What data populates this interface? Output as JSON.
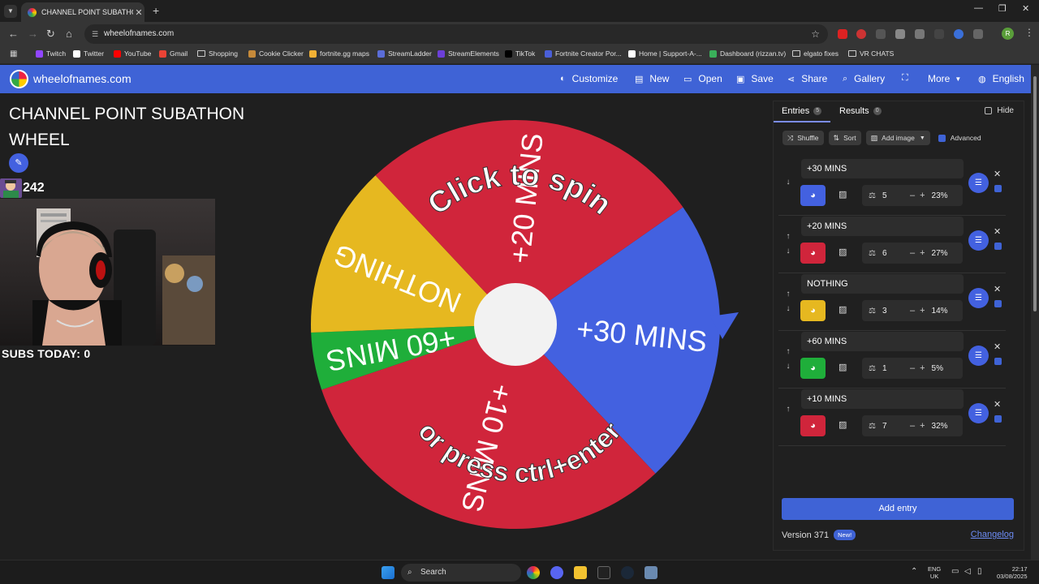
{
  "browser": {
    "tab_title": "CHANNEL POINT SUBATHON W",
    "url": "wheelofnames.com",
    "bookmarks": [
      {
        "label": "Twitch",
        "color": "#9146ff"
      },
      {
        "label": "Twitter",
        "color": "#ffffff"
      },
      {
        "label": "YouTube",
        "color": "#ff0000"
      },
      {
        "label": "Gmail",
        "color": "#ea4335"
      },
      {
        "label": "Shopping",
        "color": "folder"
      },
      {
        "label": "Cookie Clicker",
        "color": "#c68a3a"
      },
      {
        "label": "fortnite.gg maps",
        "color": "#f2b134"
      },
      {
        "label": "StreamLadder",
        "color": "#5b6dd8"
      },
      {
        "label": "StreamElements",
        "color": "#6c3fd8"
      },
      {
        "label": "TikTok",
        "color": "#000000"
      },
      {
        "label": "Fortnite Creator Por...",
        "color": "#4a5fd8"
      },
      {
        "label": "Home | Support-A-...",
        "color": "#ffffff"
      },
      {
        "label": "Dashboard (rizzan.tv)",
        "color": "#3ab05a"
      },
      {
        "label": "elgato fixes",
        "color": "folder"
      },
      {
        "label": "VR CHATS",
        "color": "folder"
      }
    ]
  },
  "app": {
    "brand": "wheelofnames.com",
    "menu": {
      "customize": "Customize",
      "new": "New",
      "open": "Open",
      "save": "Save",
      "share": "Share",
      "gallery": "Gallery",
      "more": "More",
      "language": "English"
    }
  },
  "left": {
    "wheel_title": "CHANNEL POINT SUBATHON WHEEL",
    "sub_count": "242",
    "subs_today": "SUBS TODAY: 0"
  },
  "wheel": {
    "prompt_top": "Click to spin",
    "prompt_bottom": "or press ctrl+enter",
    "slices": [
      {
        "label": "+30 MINS",
        "color": "#4361e0",
        "weight": 5
      },
      {
        "label": "+10 MINS",
        "color": "#d0253b",
        "weight": 7
      },
      {
        "label": "+60 MINS",
        "color": "#1fae3a",
        "weight": 1
      },
      {
        "label": "NOTHING",
        "color": "#e6b820",
        "weight": 3
      },
      {
        "label": "+20 MINS",
        "color": "#d0253b",
        "weight": 6
      }
    ]
  },
  "sidebar": {
    "tab_entries": "Entries",
    "entries_count": "5",
    "tab_results": "Results",
    "results_count": "0",
    "hide": "Hide",
    "shuffle": "Shuffle",
    "sort": "Sort",
    "add_image": "Add image",
    "advanced": "Advanced",
    "entries": [
      {
        "name": "+30 MINS",
        "weight": "5",
        "percent": "23%",
        "color": "#4361e0"
      },
      {
        "name": "+20 MINS",
        "weight": "6",
        "percent": "27%",
        "color": "#d0253b"
      },
      {
        "name": "NOTHING",
        "weight": "3",
        "percent": "14%",
        "color": "#e6b820"
      },
      {
        "name": "+60 MINS",
        "weight": "1",
        "percent": "5%",
        "color": "#1fae3a"
      },
      {
        "name": "+10 MINS",
        "weight": "7",
        "percent": "32%",
        "color": "#d0253b"
      }
    ],
    "add_entry": "Add entry",
    "version": "Version 371",
    "new_badge": "New!",
    "changelog": "Changelog"
  },
  "taskbar": {
    "search": "Search",
    "lang": "ENG",
    "region": "UK",
    "time": "22:17",
    "date": "03/08/2025"
  }
}
